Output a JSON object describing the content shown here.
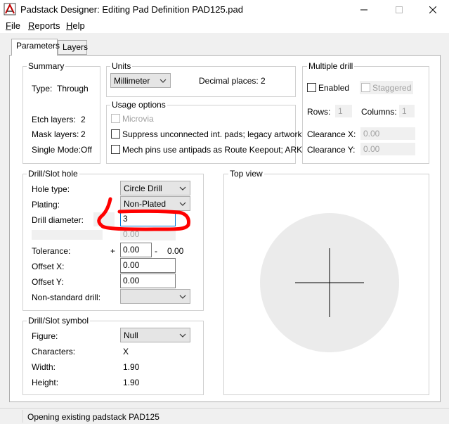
{
  "window": {
    "title": "Padstack Designer: Editing Pad Definition PAD125.pad",
    "app_icon": "padstack-app-icon",
    "controls": [
      "minimize",
      "maximize",
      "close"
    ]
  },
  "menu": [
    {
      "label": "File",
      "accel": "F",
      "rest": "ile"
    },
    {
      "label": "Reports",
      "accel": "R",
      "rest": "eports"
    },
    {
      "label": "Help",
      "accel": "H",
      "rest": "elp"
    }
  ],
  "tabs": [
    {
      "label": "Parameters",
      "active": true
    },
    {
      "label": "Layers",
      "active": false
    }
  ],
  "summary": {
    "title": "Summary",
    "type_label": "Type:",
    "type_value": "Through",
    "etch_label": "Etch layers:",
    "etch_value": "2",
    "mask_label": "Mask layers:",
    "mask_value": "2",
    "single_label": "Single Mode:",
    "single_value": "Off"
  },
  "units": {
    "title": "Units",
    "unit_value": "Millimeter",
    "decimal_label": "Decimal places:",
    "decimal_value": "2"
  },
  "usage": {
    "title": "Usage options",
    "microvia_label": "Microvia",
    "suppress_label": "Suppress unconnected int. pads; legacy artwork",
    "mech_label": "Mech pins use antipads as Route Keepout; ARK"
  },
  "multi_drill": {
    "title": "Multiple drill",
    "enabled_label": "Enabled",
    "staggered_label": "Staggered",
    "rows_label": "Rows:",
    "rows_value": "1",
    "columns_label": "Columns:",
    "columns_value": "1",
    "clearance_x_label": "Clearance X:",
    "clearance_x_value": "0.00",
    "clearance_y_label": "Clearance Y:",
    "clearance_y_value": "0.00"
  },
  "drill": {
    "title": "Drill/Slot hole",
    "hole_type_label": "Hole type:",
    "hole_type_value": "Circle Drill",
    "plating_label": "Plating:",
    "plating_value": "Non-Plated",
    "diameter_label": "Drill diameter:",
    "diameter_value": "3",
    "secondary_value": "0.00",
    "tolerance_label": "Tolerance:",
    "tol_plus": "+",
    "tol_plus_value": "0.00",
    "tol_minus": "-",
    "tol_minus_value": "0.00",
    "offset_x_label": "Offset X:",
    "offset_x_value": "0.00",
    "offset_y_label": "Offset Y:",
    "offset_y_value": "0.00",
    "nonstd_label": "Non-standard drill:",
    "nonstd_value": ""
  },
  "symbol": {
    "title": "Drill/Slot symbol",
    "figure_label": "Figure:",
    "figure_value": "Null",
    "chars_label": "Characters:",
    "chars_value": "X",
    "width_label": "Width:",
    "width_value": "1.90",
    "height_label": "Height:",
    "height_value": "1.90"
  },
  "top_view": {
    "title": "Top view"
  },
  "annotation_color": "#ff0000",
  "status": {
    "text": "Opening existing padstack PAD125"
  }
}
